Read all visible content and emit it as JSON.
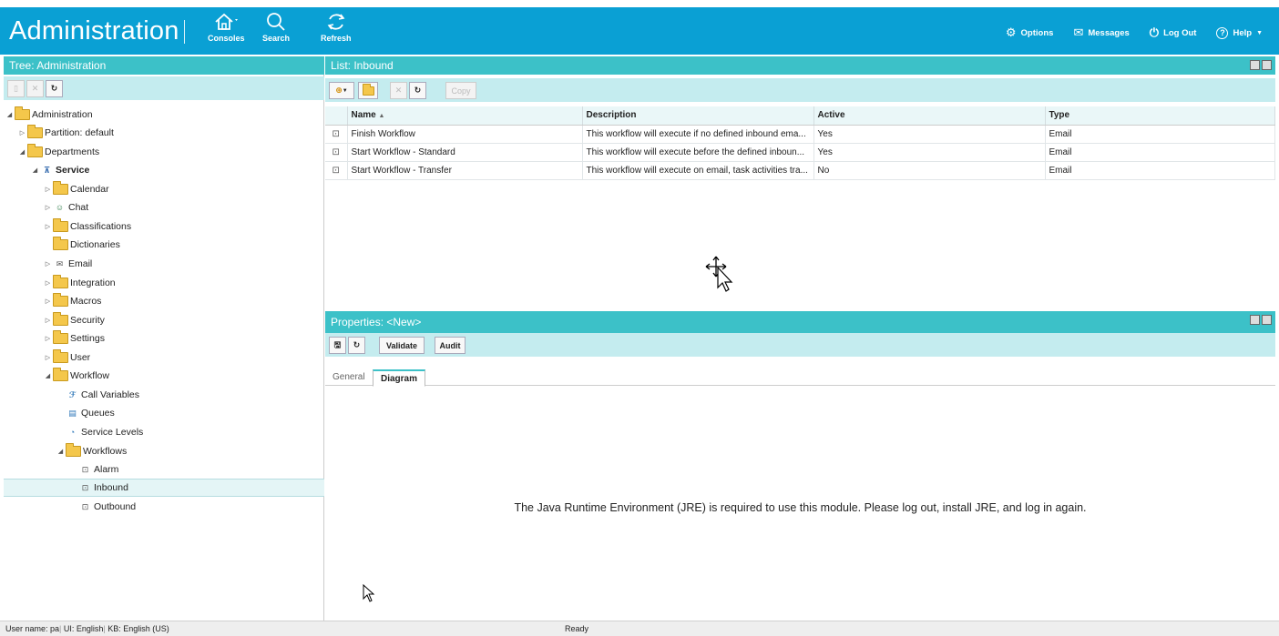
{
  "header": {
    "title": "Administration",
    "tools": {
      "consoles": "Consoles",
      "search": "Search",
      "refresh": "Refresh"
    },
    "right": {
      "options": "Options",
      "messages": "Messages",
      "logout": "Log Out",
      "help": "Help"
    }
  },
  "tree": {
    "heading": "Tree: Administration",
    "items": [
      {
        "label": "Administration"
      },
      {
        "label": "Partition: default"
      },
      {
        "label": "Departments"
      },
      {
        "label": "Service"
      },
      {
        "label": "Calendar"
      },
      {
        "label": "Chat"
      },
      {
        "label": "Classifications"
      },
      {
        "label": "Dictionaries"
      },
      {
        "label": "Email"
      },
      {
        "label": "Integration"
      },
      {
        "label": "Macros"
      },
      {
        "label": "Security"
      },
      {
        "label": "Settings"
      },
      {
        "label": "User"
      },
      {
        "label": "Workflow"
      },
      {
        "label": "Call Variables"
      },
      {
        "label": "Queues"
      },
      {
        "label": "Service Levels"
      },
      {
        "label": "Workflows"
      },
      {
        "label": "Alarm"
      },
      {
        "label": "Inbound"
      },
      {
        "label": "Outbound"
      }
    ]
  },
  "list": {
    "heading": "List: Inbound",
    "copy_label": "Copy",
    "columns": {
      "name": "Name",
      "description": "Description",
      "active": "Active",
      "type": "Type"
    },
    "rows": [
      {
        "name": "Finish Workflow",
        "description": "This workflow will execute if no defined inbound ema...",
        "active": "Yes",
        "type": "Email"
      },
      {
        "name": "Start Workflow - Standard",
        "description": "This workflow will execute before the defined inboun...",
        "active": "Yes",
        "type": "Email"
      },
      {
        "name": "Start Workflow - Transfer",
        "description": "This workflow will execute on email, task activities tra...",
        "active": "No",
        "type": "Email"
      }
    ]
  },
  "properties": {
    "heading": "Properties: <New>",
    "validate_label": "Validate",
    "audit_label": "Audit",
    "tabs": {
      "general": "General",
      "diagram": "Diagram"
    },
    "message": "The Java Runtime Environment (JRE) is required to use this module. Please log out, install JRE, and log in again."
  },
  "status": {
    "user": "User name: pa",
    "ui": "UI: English",
    "kb": "KB: English (US)",
    "state": "Ready"
  }
}
